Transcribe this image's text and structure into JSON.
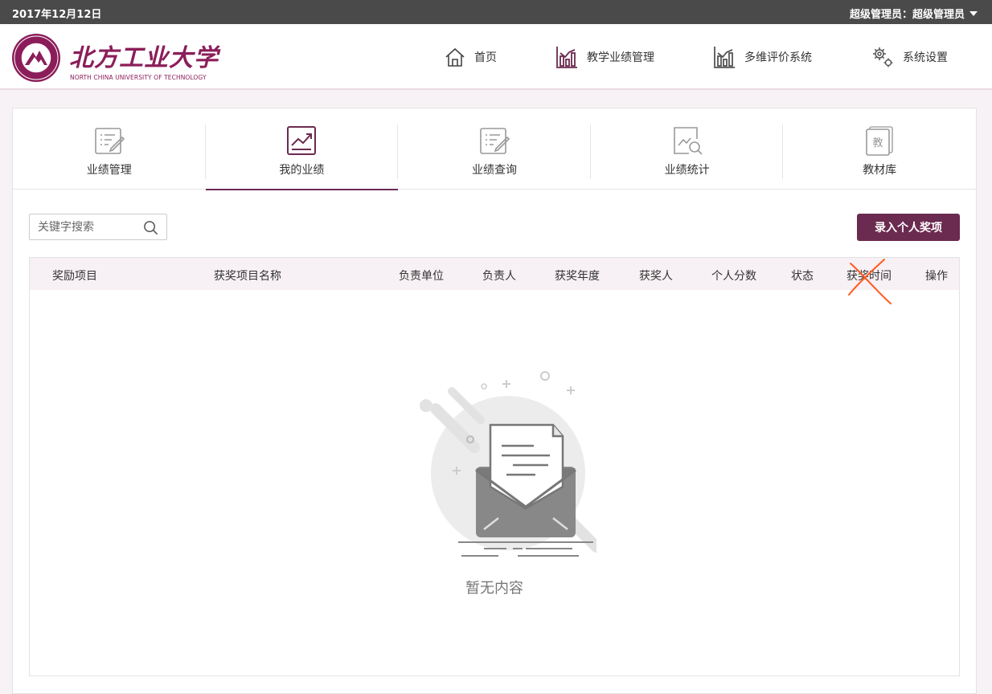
{
  "topbar": {
    "date": "2017年12月12日",
    "user": "超级管理员：超级管理员"
  },
  "logo": {
    "name_cn": "北方工业大学",
    "name_en": "NORTH CHINA UNIVERSITY OF TECHNOLOGY"
  },
  "nav": [
    {
      "label": "首页",
      "icon": "home-icon"
    },
    {
      "label": "教学业绩管理",
      "icon": "bar-chart-icon"
    },
    {
      "label": "多维评价系统",
      "icon": "bar-chart-icon"
    },
    {
      "label": "系统设置",
      "icon": "gears-icon"
    }
  ],
  "tabs": [
    {
      "label": "业绩管理",
      "icon": "edit-icon"
    },
    {
      "label": "我的业绩",
      "icon": "trend-chart-icon",
      "active": true
    },
    {
      "label": "业绩查询",
      "icon": "edit-icon"
    },
    {
      "label": "业绩统计",
      "icon": "search-chart-icon"
    },
    {
      "label": "教材库",
      "icon": "textbook-icon",
      "badge": "教"
    }
  ],
  "search": {
    "placeholder": "关键字搜索"
  },
  "actions": {
    "add_award": "录入个人奖项"
  },
  "table": {
    "headers": [
      "奖励项目",
      "获奖项目名称",
      "负责单位",
      "负责人",
      "获奖年度",
      "获奖人",
      "个人分数",
      "状态",
      "获奖时间",
      "操作"
    ],
    "rows": []
  },
  "empty_state": {
    "text": "暂无内容"
  },
  "colors": {
    "brand": "#6b2a4f",
    "header_bar": "#4a4a4a",
    "table_head": "#f7f0f4",
    "annotation": "#ff5a1f"
  }
}
